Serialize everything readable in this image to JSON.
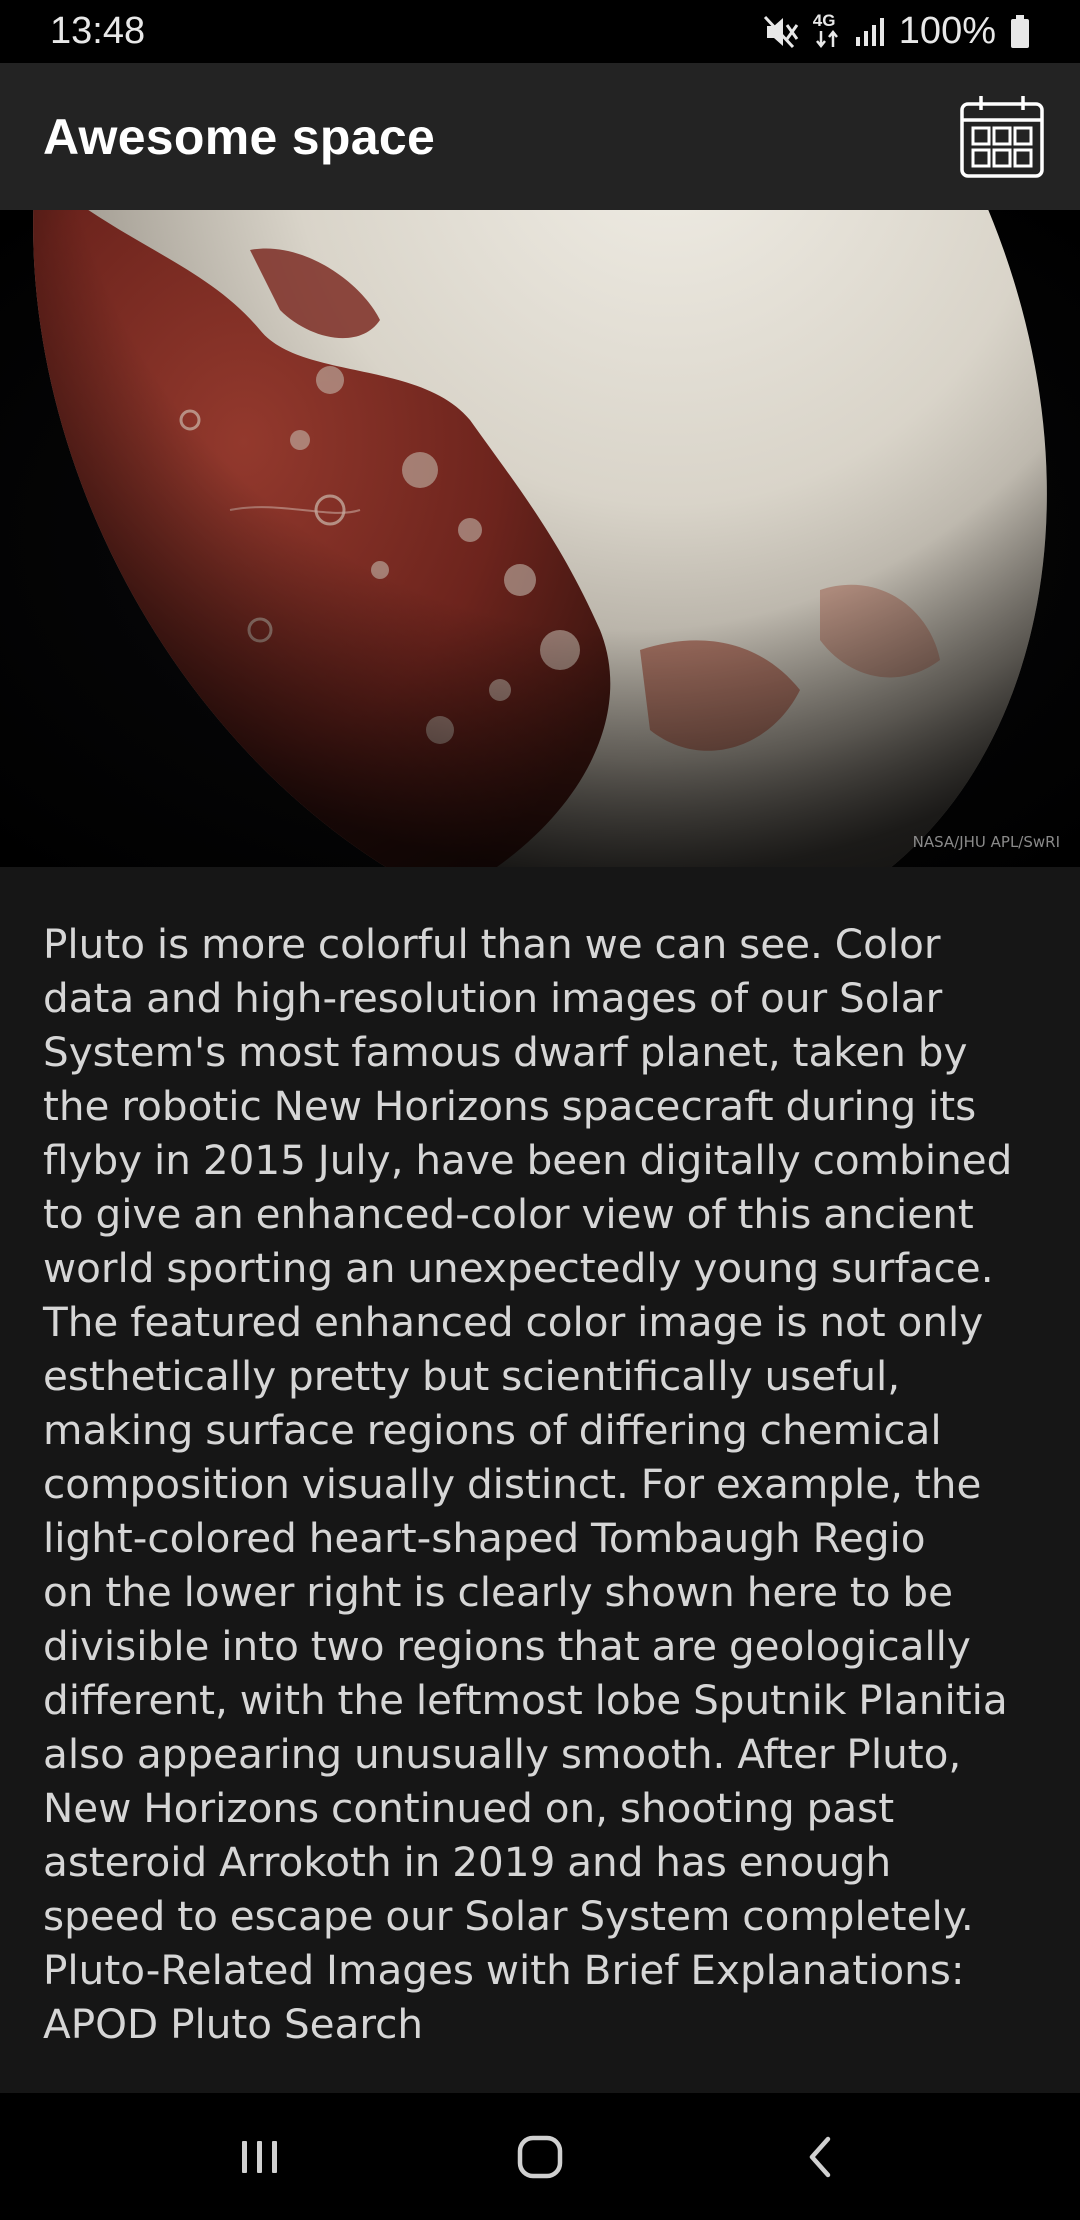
{
  "status_bar": {
    "time": "13:48",
    "network": "4G",
    "battery": "100%",
    "icons": [
      "mute-icon",
      "4g-data-icon",
      "signal-icon",
      "battery-icon"
    ]
  },
  "app_bar": {
    "title": "Awesome space",
    "calendar_icon": "calendar-icon"
  },
  "image": {
    "credit": "NASA/JHU APL/SwRI"
  },
  "explanation": "Pluto is more colorful than we can see. Color\ndata and high-resolution images of our Solar\nSystem's most famous dwarf planet, taken by\nthe robotic New Horizons spacecraft during its\nflyby in 2015 July, have been digitally combined\nto give an enhanced-color view of this ancient\nworld sporting an unexpectedly young surface.\nThe featured enhanced color image is not only\nesthetically pretty but scientifically useful,\nmaking surface regions of differing chemical\ncomposition visually distinct. For example, the\nlight-colored heart-shaped Tombaugh Regio\non the lower right is clearly shown here to be\ndivisible into two regions that are geologically\ndifferent, with the leftmost lobe Sputnik Planitia\nalso appearing unusually smooth. After Pluto,\nNew Horizons continued on, shooting  past\nasteroid Arrokoth in 2019 and has enough\nspeed to escape our Solar System completely.\nPluto-Related Images with Brief Explanations:\nAPOD Pluto Search",
  "nav_bar": {
    "icons": [
      "recent-apps-icon",
      "home-icon",
      "back-icon"
    ]
  },
  "colors": {
    "app_bar_bg": "#232323",
    "content_bg": "#161616",
    "text": "#d6d6d6",
    "pluto_red": "#7a2a22",
    "pluto_cream": "#e6e2d8"
  }
}
